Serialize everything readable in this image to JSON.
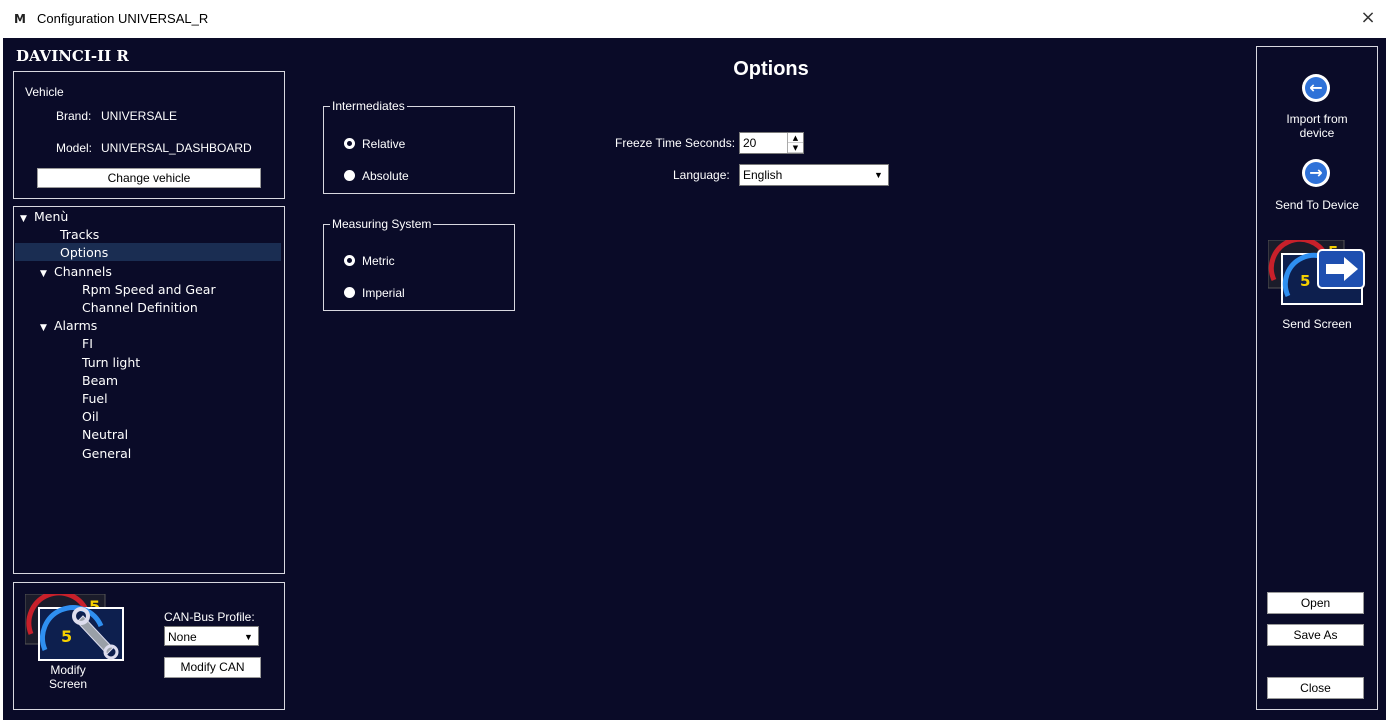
{
  "window": {
    "app_icon": "M",
    "title": "Configuration UNIVERSAL_R",
    "close_icon": "×"
  },
  "device_name": "DAVINCI-II R",
  "vehicle": {
    "section_label": "Vehicle",
    "brand_label": "Brand:",
    "brand_value": "UNIVERSALE",
    "model_label": "Model:",
    "model_value": "UNIVERSAL_DASHBOARD",
    "change_button": "Change vehicle"
  },
  "tree": {
    "selected": "Options",
    "items": [
      {
        "label": "Menù",
        "level": 0,
        "expanded": true
      },
      {
        "label": "Tracks",
        "level": 1
      },
      {
        "label": "Options",
        "level": 1
      },
      {
        "label": "Channels",
        "level": 1,
        "expanded": true
      },
      {
        "label": "Rpm Speed and Gear",
        "level": 2
      },
      {
        "label": "Channel Definition",
        "level": 2
      },
      {
        "label": "Alarms",
        "level": 1,
        "expanded": true
      },
      {
        "label": "FI",
        "level": 2
      },
      {
        "label": "Turn light",
        "level": 2
      },
      {
        "label": "Beam",
        "level": 2
      },
      {
        "label": "Fuel",
        "level": 2
      },
      {
        "label": "Oil",
        "level": 2
      },
      {
        "label": "Neutral",
        "level": 2
      },
      {
        "label": "General",
        "level": 2
      }
    ]
  },
  "bottom_left": {
    "modify_screen_label": "Modify\nScreen",
    "can_profile_label": "CAN-Bus Profile:",
    "can_profile_value": "None",
    "modify_can_button": "Modify CAN",
    "thumbnail_gear": "5"
  },
  "main": {
    "title": "Options",
    "intermediates": {
      "legend": "Intermediates",
      "options": [
        "Relative",
        "Absolute"
      ],
      "selected": "Relative"
    },
    "measuring_system": {
      "legend": "Measuring System",
      "options": [
        "Metric",
        "Imperial"
      ],
      "selected": "Metric"
    },
    "freeze_time_label": "Freeze Time Seconds:",
    "freeze_time_value": "20",
    "language_label": "Language:",
    "language_value": "English"
  },
  "right_panel": {
    "import_label": "Import from\ndevice",
    "send_device_label": "Send To Device",
    "send_screen_label": "Send Screen",
    "open_button": "Open",
    "save_as_button": "Save As",
    "close_button": "Close",
    "thumbnail_gear": "5"
  },
  "colors": {
    "background": "#0a0b28",
    "accent_blue": "#2f72d8",
    "selection": "#1a2d52"
  }
}
